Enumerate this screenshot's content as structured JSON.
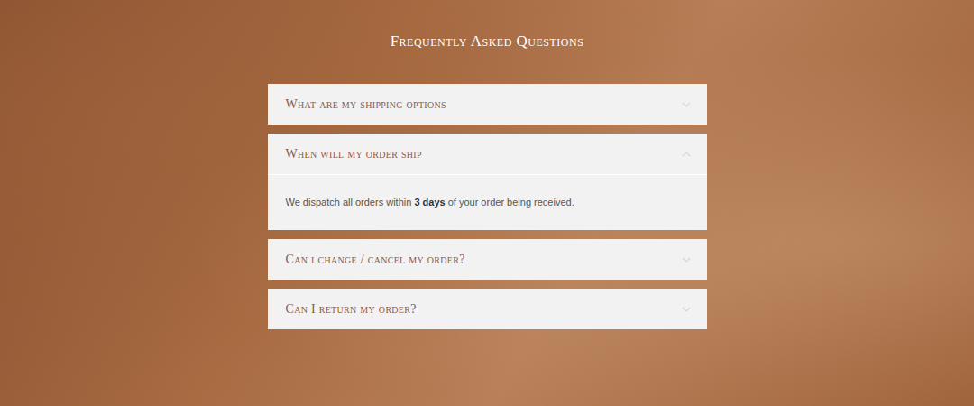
{
  "heading": "Frequently Asked Questions",
  "faq": [
    {
      "question": "What are my shipping options",
      "expanded": false,
      "answer": []
    },
    {
      "question": "When will my order ship",
      "expanded": true,
      "answer": [
        {
          "text": "We dispatch all orders within ",
          "bold": false
        },
        {
          "text": "3 days",
          "bold": true
        },
        {
          "text": " of your order being received.",
          "bold": false
        }
      ]
    },
    {
      "question": "Can i change / cancel my order?",
      "expanded": false,
      "answer": []
    },
    {
      "question": "Can I return my order?",
      "expanded": false,
      "answer": []
    }
  ]
}
